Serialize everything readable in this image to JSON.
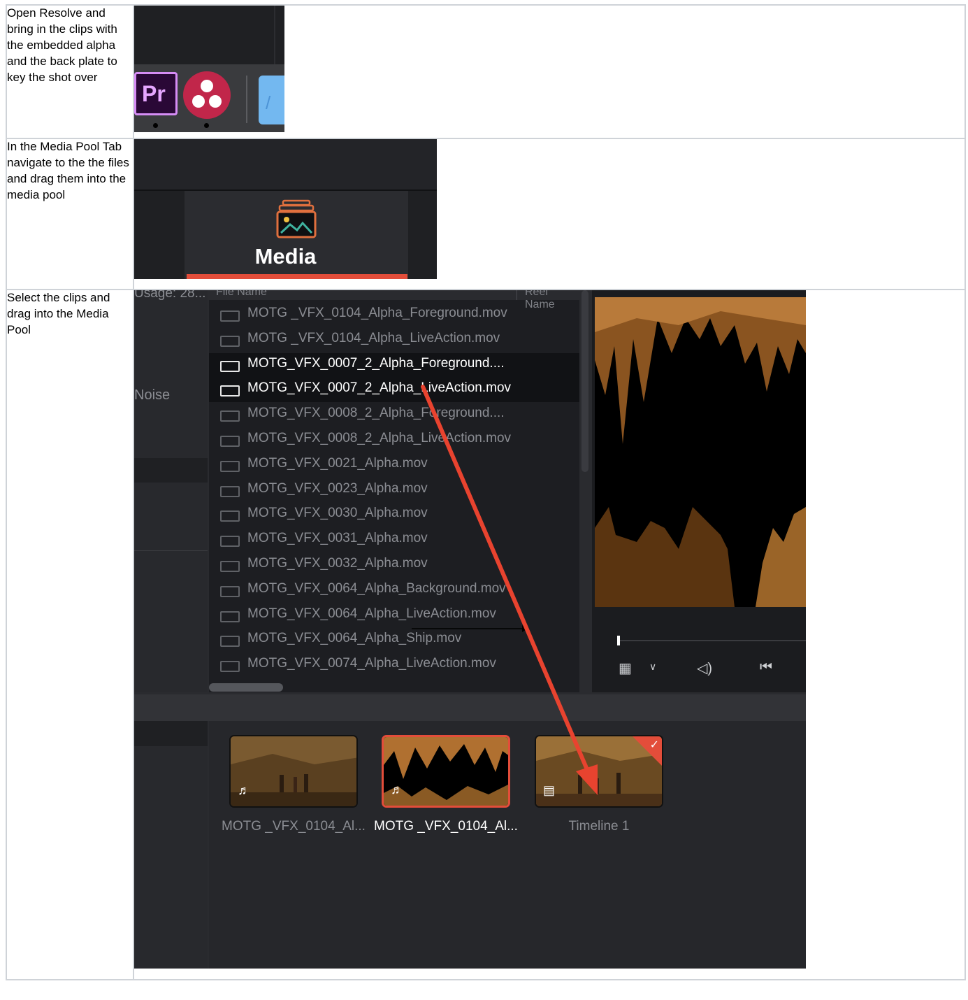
{
  "steps": [
    {
      "text": "Open Resolve and bring in the clips with the embedded alpha and the back plate to key the shot over"
    },
    {
      "text": "In the Media Pool Tab navigate to the the files and drag them into the media pool"
    },
    {
      "text": "Select the clips and drag into the Media Pool"
    }
  ],
  "dock": {
    "premiere_label": "Pr",
    "icons": [
      "premiere-icon",
      "davinci-resolve-icon",
      "applications-folder-icon"
    ]
  },
  "media_tab": {
    "label": "Media",
    "icon": "media-image-icon",
    "accent": "#e34d3a"
  },
  "media_pool": {
    "usage": "Usage: 28...",
    "noise_label": "Noise",
    "columns": [
      "File Name",
      "Reel Name"
    ],
    "files": [
      {
        "name": "MOTG _VFX_0104_Alpha_Foreground.mov",
        "selected": false
      },
      {
        "name": "MOTG _VFX_0104_Alpha_LiveAction.mov",
        "selected": false
      },
      {
        "name": "MOTG_VFX_0007_2_Alpha_Foreground....",
        "selected": true
      },
      {
        "name": "MOTG_VFX_0007_2_Alpha_LiveAction.mov",
        "selected": true
      },
      {
        "name": "MOTG_VFX_0008_2_Alpha_Foreground....",
        "selected": false
      },
      {
        "name": "MOTG_VFX_0008_2_Alpha_LiveAction.mov",
        "selected": false
      },
      {
        "name": "MOTG_VFX_0021_Alpha.mov",
        "selected": false
      },
      {
        "name": "MOTG_VFX_0023_Alpha.mov",
        "selected": false
      },
      {
        "name": "MOTG_VFX_0030_Alpha.mov",
        "selected": false
      },
      {
        "name": "MOTG_VFX_0031_Alpha.mov",
        "selected": false
      },
      {
        "name": "MOTG_VFX_0032_Alpha.mov",
        "selected": false
      },
      {
        "name": "MOTG_VFX_0064_Alpha_Background.mov",
        "selected": false
      },
      {
        "name": "MOTG_VFX_0064_Alpha_LiveAction.mov",
        "selected": false
      },
      {
        "name": "MOTG_VFX_0064_Alpha_Ship.mov",
        "selected": false
      },
      {
        "name": "MOTG_VFX_0074_Alpha_LiveAction.mov",
        "selected": false
      }
    ],
    "clips": [
      {
        "label": "MOTG _VFX_0104_Al...",
        "icon": "audio-note-icon",
        "selected": false
      },
      {
        "label": "MOTG _VFX_0104_Al...",
        "icon": "audio-note-icon",
        "selected": true
      },
      {
        "label": "Timeline 1",
        "icon": "timeline-icon",
        "selected": false,
        "checked": true
      }
    ],
    "accent": "#e34d3a"
  }
}
